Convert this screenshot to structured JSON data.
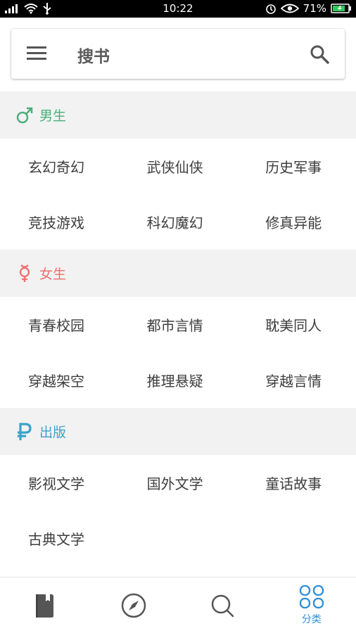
{
  "status_bar": {
    "time": "10:22",
    "battery_percent": "71%"
  },
  "header": {
    "title": "搜书"
  },
  "sections": [
    {
      "label": "男生",
      "color": "#4caf7a",
      "icon": "male-icon",
      "items": [
        "玄幻奇幻",
        "武侠仙侠",
        "历史军事",
        "竞技游戏",
        "科幻魔幻",
        "修真异能"
      ]
    },
    {
      "label": "女生",
      "color": "#ef6f6f",
      "icon": "female-icon",
      "items": [
        "青春校园",
        "都市言情",
        "耽美同人",
        "穿越架空",
        "推理悬疑",
        "穿越言情"
      ]
    },
    {
      "label": "出版",
      "color": "#3aa3c9",
      "icon": "ruble-icon",
      "items": [
        "影视文学",
        "国外文学",
        "童话故事",
        "古典文学"
      ]
    }
  ],
  "bottom_nav": {
    "active_label": "分类",
    "active_color": "#2f8fd6",
    "items": [
      "book-icon",
      "compass-icon",
      "search-icon",
      "grid-icon"
    ]
  }
}
